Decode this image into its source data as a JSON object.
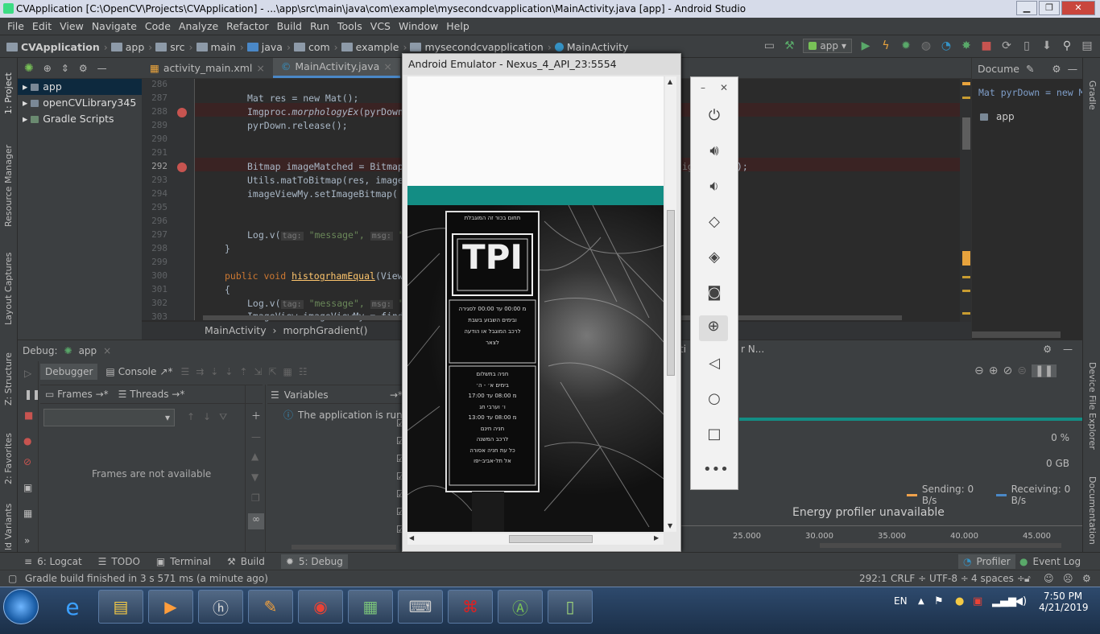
{
  "window": {
    "title": "CVApplication [C:\\OpenCV\\Projects\\CVApplication] - ...\\app\\src\\main\\java\\com\\example\\mysecondcvapplication\\MainActivity.java [app] - Android Studio",
    "min": "▁",
    "max": "❐",
    "close": "✕"
  },
  "menu": [
    "File",
    "Edit",
    "View",
    "Navigate",
    "Code",
    "Analyze",
    "Refactor",
    "Build",
    "Run",
    "Tools",
    "VCS",
    "Window",
    "Help"
  ],
  "breadcrumbs": [
    "CVApplication",
    "app",
    "src",
    "main",
    "java",
    "com",
    "example",
    "mysecondcvapplication",
    "MainActivity"
  ],
  "toolbar": {
    "run_config": "app"
  },
  "left_strip": {
    "project": "1: Project",
    "resource": "Resource Manager",
    "layout": "Layout Captures",
    "structure": "Z: Structure",
    "favorites": "2: Favorites",
    "variants": "ld Variants"
  },
  "right_strip": {
    "gradle": "Gradle",
    "device": "Device File Explorer",
    "docs": "Documentation"
  },
  "project_tree": [
    {
      "label": "app",
      "selected": true
    },
    {
      "label": "openCVLibrary345",
      "selected": false
    },
    {
      "label": "Gradle Scripts",
      "selected": false
    }
  ],
  "editor": {
    "tabs": [
      {
        "label": "activity_main.xml"
      },
      {
        "label": "MainActivity.java"
      }
    ],
    "breadcrumb": {
      "class": "MainActivity",
      "method": "morphGradient()"
    }
  },
  "line_numbers": [
    "286",
    "287",
    "288",
    "289",
    "290",
    "291",
    "292",
    "293",
    "294",
    "295",
    "296",
    "297",
    "298",
    "299",
    "300",
    "301",
    "302",
    "303"
  ],
  "code": {
    "l287": "Mat res = new Mat();",
    "l288a": "Imgproc.",
    "l288b": "morphologyEx",
    "l288c": "(pyrDown,",
    "l289": "pyrDown.release();",
    "l292": "Bitmap imageMatched = Bitmap",
    "l292tail": "ig",
    "l292end": ");",
    "l293": "Utils.matToBitmap(res, image",
    "l294": "imageViewMy.setImageBitmap(",
    "l297a": "Log.v(",
    "tag": "tag:",
    "msg_str": "\"message\",",
    "msg": "msg:",
    "quote": "\"",
    "l298": "}",
    "l300a": "public void ",
    "l300b": "histogrhamEqual",
    "l300c": "(View",
    "l301": "{",
    "l303": "ImageView imageViewMy = find"
  },
  "structure": {
    "title": "Docume",
    "code": "Mat pyrDown = new M",
    "item": "app"
  },
  "debug": {
    "label": "Debug:",
    "config": "app",
    "tabs": {
      "debugger": "Debugger",
      "console": "Console"
    },
    "frames": "Frames",
    "threads": "Threads",
    "variables": "Variables",
    "frames_empty": "Frames are not available",
    "info": "The application is runn"
  },
  "profiler": {
    "fragment": "ti",
    "fragment2": "r N...",
    "percent": "0 %",
    "memory": "0 GB",
    "sending": "Sending: 0 B/s",
    "receiving": "Receiving: 0 B/s",
    "energy": "Energy profiler unavailable",
    "axis": [
      "25.000",
      "30.000",
      "35.000",
      "40.000",
      "45.000"
    ]
  },
  "emulator": {
    "title": "Android Emulator - Nexus_4_API_23:5554",
    "sign_lines": [
      "תחום בכור זה המוגבלת",
      "TPI",
      "מ 00:00 עד 00:00 לסגירה",
      "ובימים השבוע בשבת",
      "לרכב המוגבל או הודעה",
      "לצאר",
      "חניה בתשלום",
      "בימים א׳ - ה׳",
      "מ 08:00 עד 17:00",
      "ו׳ וערבי חג",
      "מ 08:00 עד 13:00",
      "חניה חינם",
      "לרכב המשנה",
      "כל עת חניה אסורה",
      "אל תל-אביב-יפו"
    ],
    "colors": {
      "teal": "#138d84"
    }
  },
  "bottom_tabs": [
    "6: Logcat",
    "TODO",
    "Terminal",
    "Build",
    "5: Debug",
    "Profiler",
    "Event Log"
  ],
  "status": {
    "message": "Gradle build finished in 3 s 571 ms (a minute ago)",
    "position": "292:1",
    "crlf": "CRLF ÷",
    "encoding": "UTF-8 ÷",
    "indent": "4 spaces ÷"
  },
  "taskbar": {
    "lang": "EN",
    "time": "7:50 PM",
    "date": "4/21/2019"
  }
}
